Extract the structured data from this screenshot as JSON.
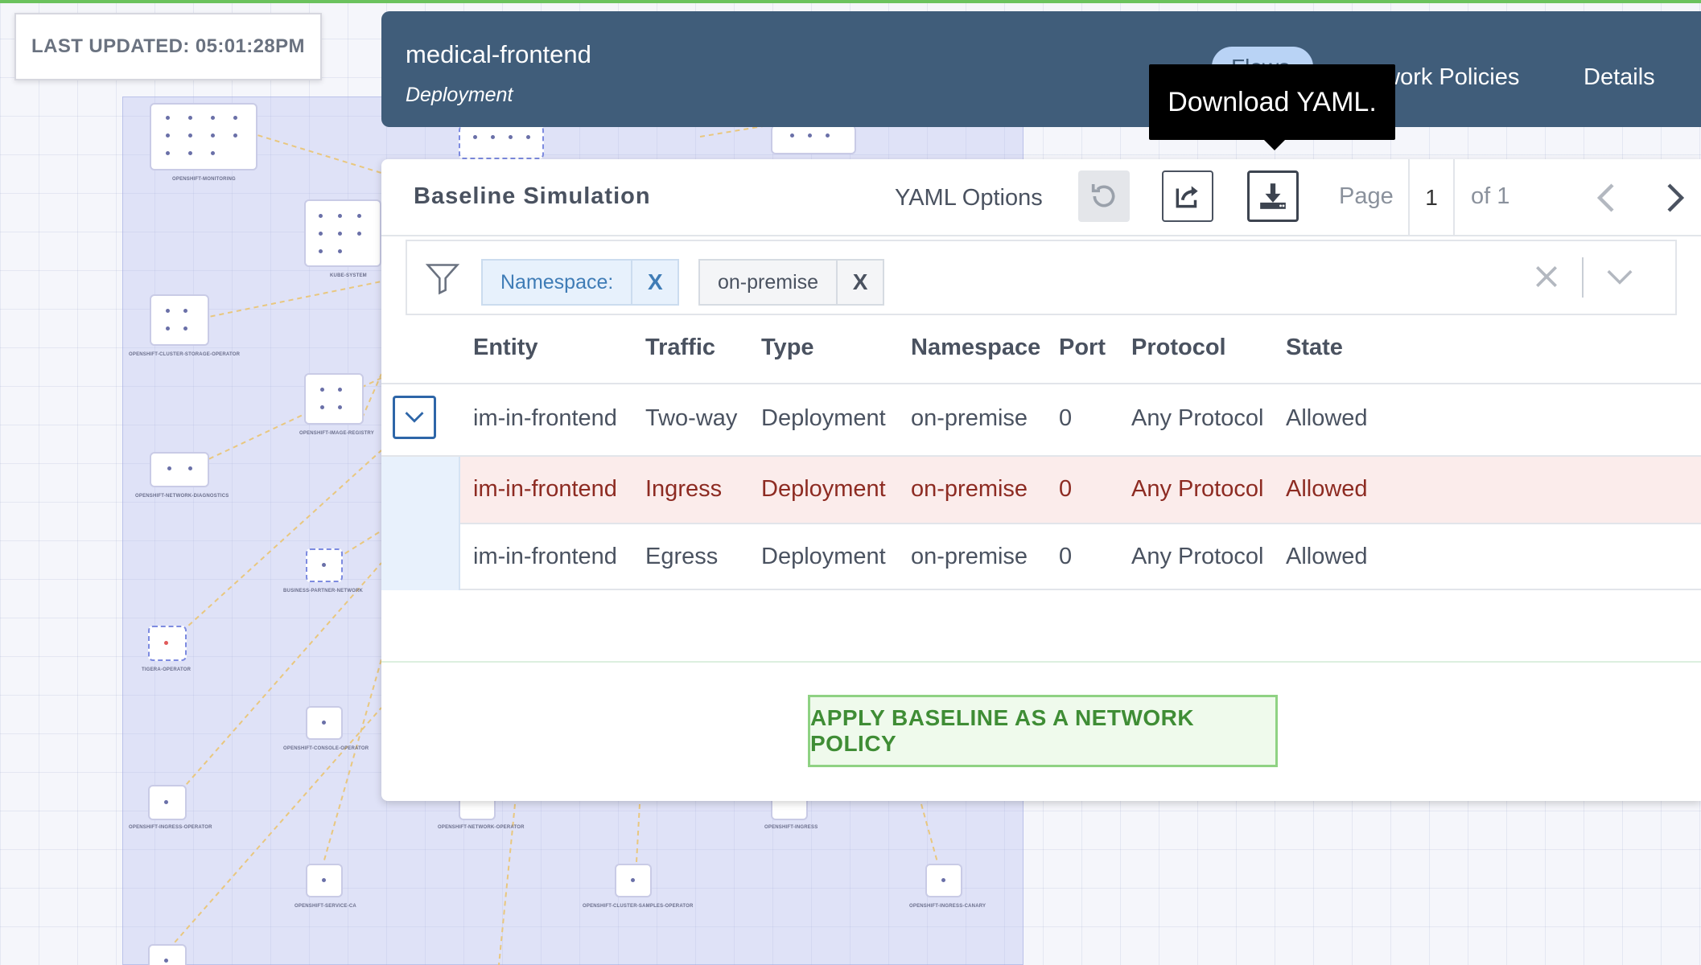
{
  "last_updated": "LAST UPDATED: 05:01:28PM",
  "header": {
    "title": "medical-frontend",
    "subtitle": "Deployment",
    "tabs": [
      "Flows",
      "Network Policies",
      "Details"
    ]
  },
  "tooltip": "Download YAML.",
  "panel": {
    "title": "Baseline Simulation",
    "yaml_options": "YAML Options",
    "page_label": "Page",
    "page_value": "1",
    "page_of": "of 1"
  },
  "filter": {
    "chip1_label": "Namespace:",
    "chip2_label": "on-premise",
    "chip_remove": "X"
  },
  "table": {
    "columns": [
      "Entity",
      "Traffic",
      "Type",
      "Namespace",
      "Port",
      "Protocol",
      "State"
    ],
    "rows": [
      [
        "im-in-frontend",
        "Two-way",
        "Deployment",
        "on-premise",
        "0",
        "Any Protocol",
        "Allowed"
      ],
      [
        "im-in-frontend",
        "Ingress",
        "Deployment",
        "on-premise",
        "0",
        "Any Protocol",
        "Allowed"
      ],
      [
        "im-in-frontend",
        "Egress",
        "Deployment",
        "on-premise",
        "0",
        "Any Protocol",
        "Allowed"
      ]
    ]
  },
  "apply_button": "APPLY BASELINE AS A NETWORK POLICY",
  "graph_labels": {
    "n1": "OPENSHIFT-MONITORING",
    "n2": "KUBE-SYSTEM",
    "n3": "OPENSHIFT-CLUSTER-STORAGE-OPERATOR",
    "n4": "OPENSHIFT-IMAGE-REGISTRY",
    "n5": "OPENSHIFT-NETWORK-DIAGNOSTICS",
    "n6": "BUSINESS-PARTNER-NETWORK",
    "n7": "TIGERA-OPERATOR",
    "n8": "OPENSHIFT-CONSOLE-OPERATOR",
    "n9": "OPENSHIFT-INGRESS-OPERATOR",
    "n10": "OPENSHIFT-SERVICE-CA",
    "n11": "OPENSHIFT-NETWORK-OPERATOR",
    "n12": "OPENSHIFT-INGRESS",
    "n13": "OPENSHIFT-CLUSTER-SAMPLES-OPERATOR",
    "n14": "OPENSHIFT-INGRESS-CANARY"
  },
  "colors": {
    "header_bg": "#405d7a",
    "accent_green": "#3f8d35",
    "ingress_row_bg": "#fbeceb",
    "link_blue": "#3f7cb6"
  }
}
